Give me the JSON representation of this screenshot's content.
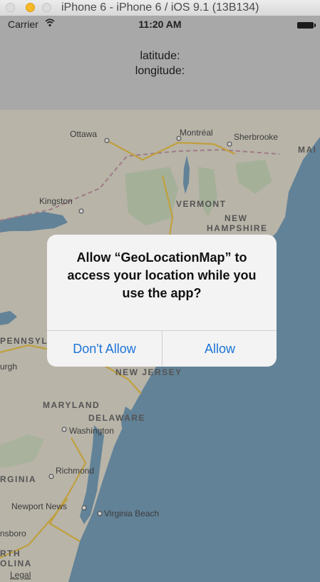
{
  "window": {
    "title": "iPhone 6 - iPhone 6 / iOS 9.1 (13B134)"
  },
  "status_bar": {
    "carrier": "Carrier",
    "time": "11:20 AM"
  },
  "header": {
    "latitude_label": "latitude:",
    "longitude_label": "longitude:"
  },
  "map": {
    "cities": {
      "ottawa": "Ottawa",
      "montreal": "Montréal",
      "sherbrooke": "Sherbrooke",
      "kingston": "Kingston",
      "washington": "Washington",
      "richmond": "Richmond",
      "newport_news": "Newport News",
      "virginia_beach": "Virginia Beach",
      "ensboro": "nsboro"
    },
    "regions": {
      "maine": "MAI",
      "vermont": "VERMONT",
      "new_hampshire_1": "NEW",
      "new_hampshire_2": "HAMPSHIRE",
      "pennsylvania": "PENNSYL",
      "pittsburgh": "urgh",
      "new_jersey": "NEW JERSEY",
      "maryland": "MARYLAND",
      "delaware": "DELAWARE",
      "virginia": "RGINIA",
      "north_carolina_1": "RTH",
      "north_carolina_2": "OLINA"
    },
    "legal": "Legal"
  },
  "alert": {
    "message": "Allow “GeoLocationMap” to access your location while you use the app?",
    "dont_allow": "Don't Allow",
    "allow": "Allow"
  },
  "colors": {
    "accent": "#1d74d6",
    "minimize": "#f7b928"
  }
}
